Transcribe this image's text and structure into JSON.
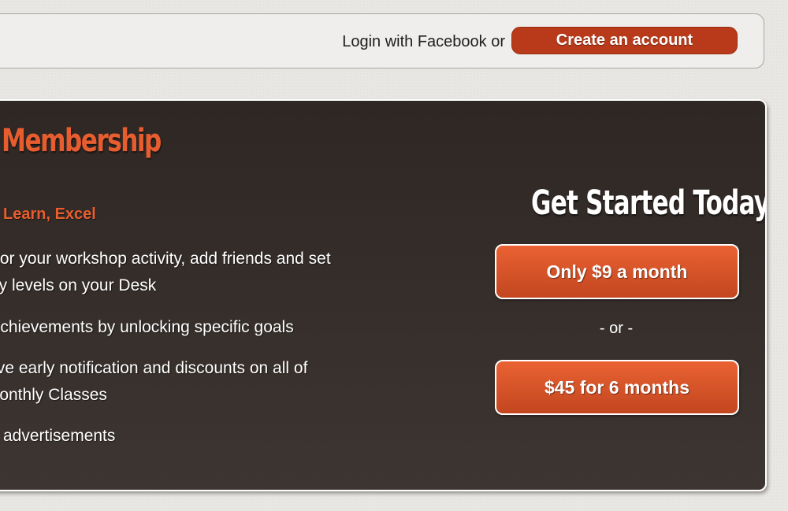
{
  "header": {
    "login_text": "Login with Facebook or",
    "create_account_label": "Create an account"
  },
  "membership": {
    "title": "Membership",
    "subtitle": "rk, Learn, Excel",
    "features": [
      "onitor your workshop activity, add friends and set\nvacy levels on your Desk",
      "rn Achievements by unlocking specific goals",
      "ceive early notification and discounts on all of\nr monthly Classes",
      "advertisements"
    ]
  },
  "signup": {
    "heading": "Get Started Today",
    "monthly_label": "Only $9 a month",
    "or_text": "- or -",
    "six_month_label": "$45 for 6 months"
  },
  "colors": {
    "accent": "#e85d2f",
    "button": "#b83a1a",
    "panel": "#2e2724"
  }
}
